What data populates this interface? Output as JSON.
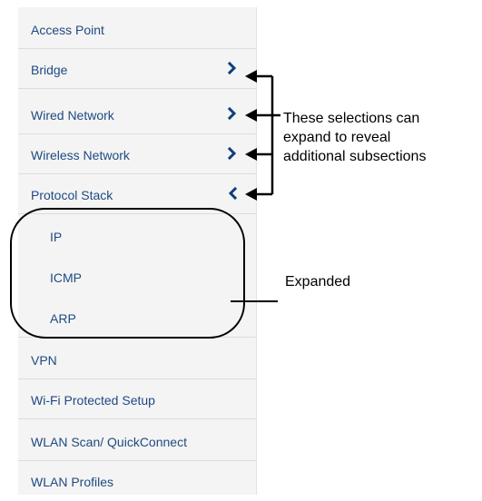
{
  "menu": {
    "items": [
      {
        "label": "Access Point"
      },
      {
        "label": "Bridge"
      },
      {
        "label": "Wired Network"
      },
      {
        "label": "Wireless Network"
      },
      {
        "label": "Protocol Stack"
      },
      {
        "label": "IP"
      },
      {
        "label": "ICMP"
      },
      {
        "label": "ARP"
      },
      {
        "label": "VPN"
      },
      {
        "label": "Wi-Fi Protected Setup"
      },
      {
        "label": "WLAN Scan/ QuickConnect"
      },
      {
        "label": "WLAN Profiles"
      }
    ]
  },
  "annotations": {
    "expand_note_line1": "These selections can",
    "expand_note_line2": "expand to reveal",
    "expand_note_line3": "additional subsections",
    "expanded_label": "Expanded"
  },
  "colors": {
    "menu_text": "#1e4a82",
    "chevron": "#0f3f7a",
    "menu_bg": "#f4f4f4"
  }
}
